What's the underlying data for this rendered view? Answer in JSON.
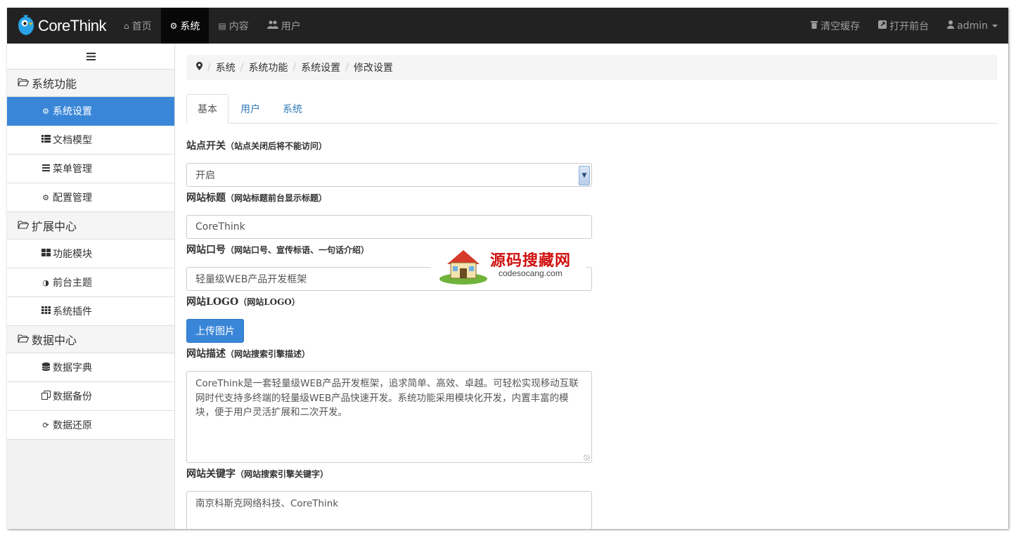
{
  "brand": {
    "name": "CoreThink"
  },
  "nav": {
    "left": [
      {
        "label": "首页",
        "icon": "home-icon",
        "active": false
      },
      {
        "label": "系统",
        "icon": "gear-icon",
        "active": true
      },
      {
        "label": "内容",
        "icon": "list-icon",
        "active": false
      },
      {
        "label": "用户",
        "icon": "users-icon",
        "active": false
      }
    ],
    "right": [
      {
        "label": "清空缓存",
        "icon": "trash-icon"
      },
      {
        "label": "打开前台",
        "icon": "external-link-icon"
      },
      {
        "label": "admin",
        "icon": "user-icon"
      }
    ]
  },
  "sidebar": {
    "toggle_icon": "menu-icon",
    "groups": [
      {
        "label": "系统功能",
        "icon": "folder-open-icon",
        "items": [
          {
            "label": "系统设置",
            "icon": "gears-icon",
            "active": true
          },
          {
            "label": "文档模型",
            "icon": "th-list-icon",
            "active": false
          },
          {
            "label": "菜单管理",
            "icon": "bars-icon",
            "active": false
          },
          {
            "label": "配置管理",
            "icon": "gears-icon",
            "active": false
          }
        ]
      },
      {
        "label": "扩展中心",
        "icon": "folder-open-icon",
        "items": [
          {
            "label": "功能模块",
            "icon": "th-large-icon",
            "active": false
          },
          {
            "label": "前台主题",
            "icon": "adjust-icon",
            "active": false
          },
          {
            "label": "系统插件",
            "icon": "th-icon",
            "active": false
          }
        ]
      },
      {
        "label": "数据中心",
        "icon": "folder-open-icon",
        "items": [
          {
            "label": "数据字典",
            "icon": "database-icon",
            "active": false
          },
          {
            "label": "数据备份",
            "icon": "copy-icon",
            "active": false
          },
          {
            "label": "数据还原",
            "icon": "refresh-icon",
            "active": false
          }
        ]
      }
    ]
  },
  "breadcrumb": {
    "icon": "map-marker-icon",
    "items": [
      "系统",
      "系统功能",
      "系统设置",
      "修改设置"
    ]
  },
  "tabs": [
    {
      "label": "基本",
      "active": true
    },
    {
      "label": "用户",
      "active": false
    },
    {
      "label": "系统",
      "active": false
    }
  ],
  "form": {
    "site_switch": {
      "label": "站点开关",
      "hint": "（站点关闭后将不能访问）",
      "value": "开启"
    },
    "site_title": {
      "label": "网站标题",
      "hint": "（网站标题前台显示标题）",
      "value": "CoreThink"
    },
    "site_slogan": {
      "label": "网站口号",
      "hint": "（网站口号、宣传标语、一句话介绍）",
      "value": "轻量级WEB产品开发框架"
    },
    "site_logo": {
      "label": "网站LOGO",
      "hint": "（网站LOGO）",
      "button": "上传图片"
    },
    "site_desc": {
      "label": "网站描述",
      "hint": "（网站搜索引擎描述）",
      "value": "CoreThink是一套轻量级WEB产品开发框架，追求简单、高效、卓越。可轻松实现移动互联网时代支持多终端的轻量级WEB产品快速开发。系统功能采用模块化开发，内置丰富的模块，便于用户灵活扩展和二次开发。"
    },
    "site_keywords": {
      "label": "网站关键字",
      "hint": "（网站搜索引擎关键字）",
      "value": "南京科斯克网络科技、CoreThink"
    }
  },
  "watermark": {
    "title": "源码搜藏网",
    "url": "codesocang.com"
  }
}
